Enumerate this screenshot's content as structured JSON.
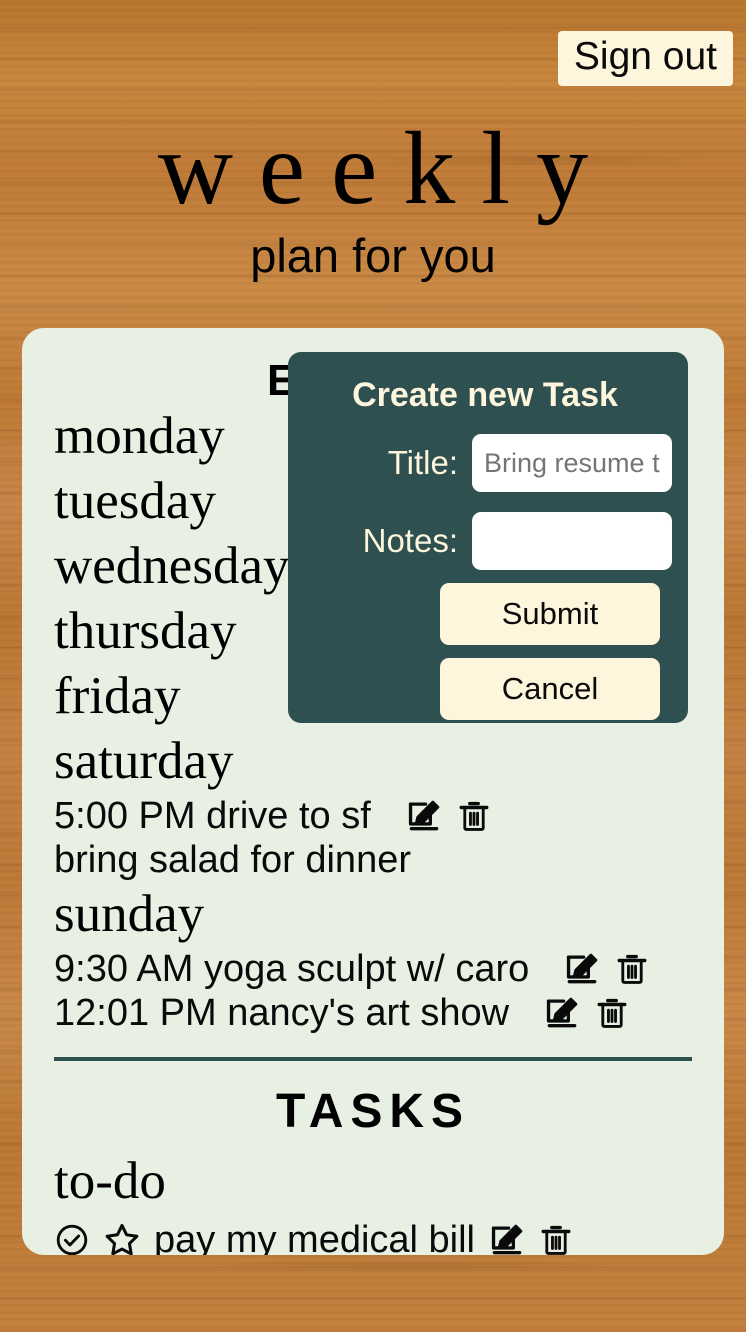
{
  "header": {
    "signout_label": "Sign out",
    "title": "weekly",
    "subtitle": "plan for you"
  },
  "colors": {
    "wood": "#c6803f",
    "card_bg": "#e8f0e4",
    "modal_bg": "#2f5050",
    "cream": "#fdf5dc",
    "text": "#0a0a0a"
  },
  "planner": {
    "events_heading": "EVENTS",
    "days": [
      {
        "name": "monday",
        "events": []
      },
      {
        "name": "tuesday",
        "events": []
      },
      {
        "name": "wednesday",
        "events": []
      },
      {
        "name": "thursday",
        "events": []
      },
      {
        "name": "friday",
        "events": []
      },
      {
        "name": "saturday",
        "events": [
          {
            "time": "5:00 PM",
            "title": "drive to sf",
            "note": "bring salad for dinner"
          }
        ]
      },
      {
        "name": "sunday",
        "events": [
          {
            "time": "9:30 AM",
            "title": "yoga sculpt w/ caro",
            "note": ""
          },
          {
            "time": "12:01 PM",
            "title": "nancy's art show",
            "note": ""
          }
        ]
      }
    ],
    "event_rows": [
      {
        "text": "5:00 PM drive to sf"
      },
      {
        "text": "9:30 AM yoga sculpt w/ caro"
      },
      {
        "text": "12:01 PM nancy's art show"
      }
    ],
    "saturday_note": "bring salad for dinner",
    "tasks_heading": "TASKS",
    "task_group": "to-do",
    "tasks": [
      {
        "text": "pay my medical bill",
        "done": false,
        "starred": false
      }
    ]
  },
  "modal": {
    "title": "Create new Task",
    "title_label": "Title:",
    "title_value": "",
    "title_placeholder": "Bring resume to career fair",
    "notes_label": "Notes:",
    "notes_value": "",
    "notes_placeholder": "",
    "submit_label": "Submit",
    "cancel_label": "Cancel"
  },
  "icons": {
    "edit": "edit-icon",
    "delete": "trash-icon",
    "complete": "check-circle-icon",
    "star": "star-icon"
  }
}
